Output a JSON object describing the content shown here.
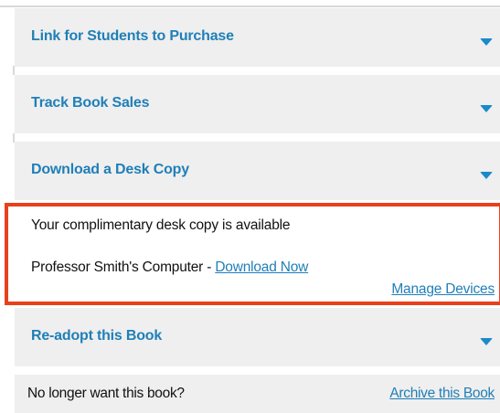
{
  "sections": [
    {
      "title": "Link for Students to Purchase"
    },
    {
      "title": "Track Book Sales"
    },
    {
      "title": "Download a Desk Copy"
    },
    {
      "title": "Re-adopt this Book"
    }
  ],
  "desk_copy": {
    "available_text": "Your complimentary desk copy is available",
    "device_label": "Professor Smith's Computer - ",
    "download_link": "Download Now",
    "manage_link": "Manage Devices"
  },
  "archive": {
    "question": "No longer want this book?",
    "link": "Archive this Book"
  },
  "colors": {
    "accent": "#1f7fb8",
    "highlight": "#e8401c",
    "panel": "#efefef"
  },
  "icons": [
    "chevron-down-icon"
  ]
}
